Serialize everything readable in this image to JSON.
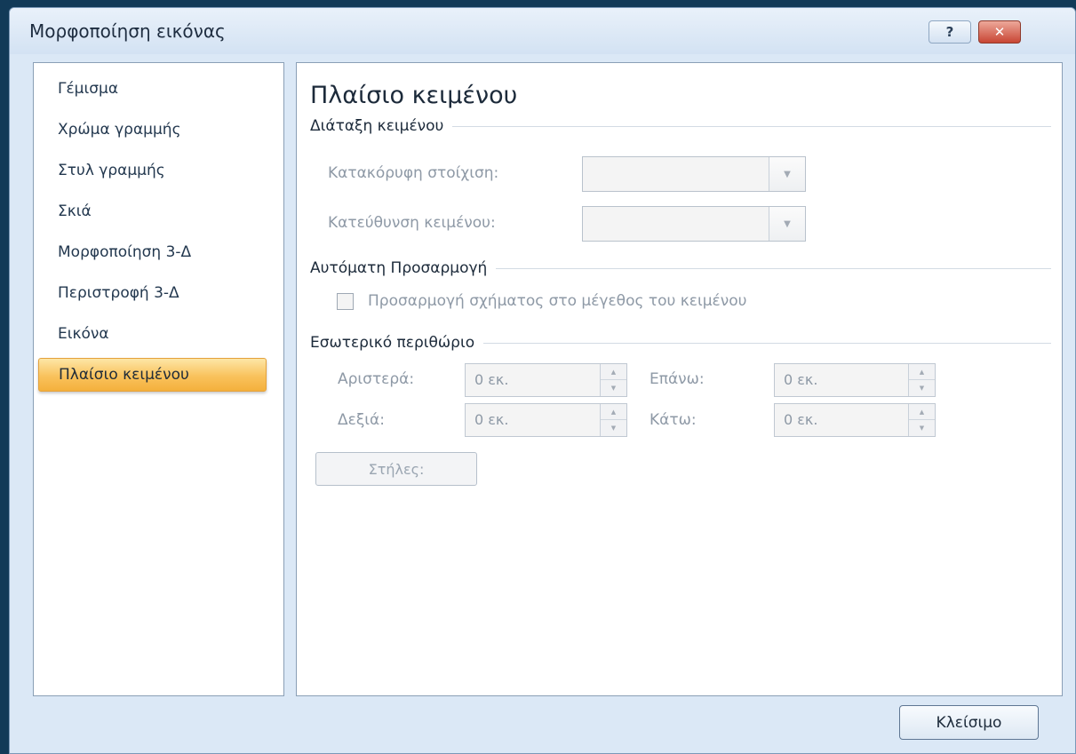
{
  "window": {
    "title": "Μορφοποίηση εικόνας",
    "help_label": "?",
    "close_label": "✕"
  },
  "nav": {
    "items": [
      {
        "label": "Γέμισμα"
      },
      {
        "label": "Χρώμα γραμμής"
      },
      {
        "label": "Στυλ γραμμής"
      },
      {
        "label": "Σκιά"
      },
      {
        "label": "Μορφοποίηση 3-Δ"
      },
      {
        "label": "Περιστροφή 3-Δ"
      },
      {
        "label": "Εικόνα"
      },
      {
        "label": "Πλαίσιο κειμένου",
        "selected": true
      }
    ]
  },
  "panel": {
    "title": "Πλαίσιο κειμένου",
    "layout_section": "Διάταξη κειμένου",
    "vertical_alignment_label": "Κατακόρυφη στοίχιση:",
    "text_direction_label": "Κατεύθυνση κειμένου:",
    "autofit_section": "Αυτόματη Προσαρμογή",
    "resize_shape_label": "Προσαρμογή σχήματος στο μέγεθος του κειμένου",
    "resize_shape_checked": false,
    "margin_section": "Εσωτερικό περιθώριο",
    "margins": {
      "left_label": "Αριστερά:",
      "left_value": "0 εκ.",
      "top_label": "Επάνω:",
      "top_value": "0 εκ.",
      "right_label": "Δεξιά:",
      "right_value": "0 εκ.",
      "bottom_label": "Κάτω:",
      "bottom_value": "0 εκ."
    },
    "columns_button": "Στήλες:"
  },
  "footer": {
    "close_button": "Κλείσιμο"
  },
  "colors": {
    "selected_item": "#f9c25c",
    "dialog_background": "#dbe8f6",
    "close_button": "#c84634"
  }
}
